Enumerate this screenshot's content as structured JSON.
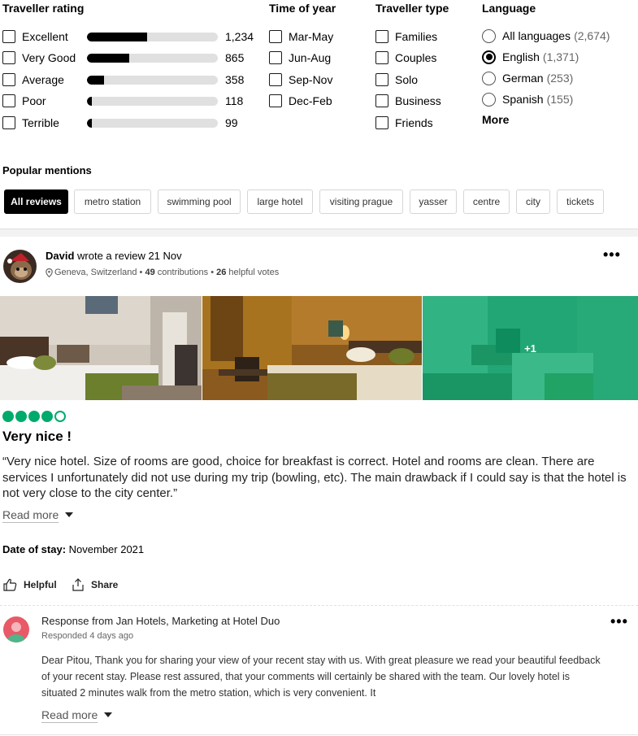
{
  "filters": {
    "rating": {
      "title": "Traveller rating",
      "items": [
        {
          "label": "Excellent",
          "count": "1,234",
          "fraction": 0.46
        },
        {
          "label": "Very Good",
          "count": "865",
          "fraction": 0.32
        },
        {
          "label": "Average",
          "count": "358",
          "fraction": 0.13
        },
        {
          "label": "Poor",
          "count": "118",
          "fraction": 0.04
        },
        {
          "label": "Terrible",
          "count": "99",
          "fraction": 0.035
        }
      ]
    },
    "time": {
      "title": "Time of year",
      "items": [
        "Mar-May",
        "Jun-Aug",
        "Sep-Nov",
        "Dec-Feb"
      ]
    },
    "type": {
      "title": "Traveller type",
      "items": [
        "Families",
        "Couples",
        "Solo",
        "Business",
        "Friends"
      ]
    },
    "language": {
      "title": "Language",
      "items": [
        {
          "label": "All languages",
          "count": "(2,674)",
          "selected": false
        },
        {
          "label": "English",
          "count": "(1,371)",
          "selected": true
        },
        {
          "label": "German",
          "count": "(253)",
          "selected": false
        },
        {
          "label": "Spanish",
          "count": "(155)",
          "selected": false
        }
      ],
      "more": "More"
    }
  },
  "popular": {
    "title": "Popular mentions",
    "chips": [
      "All reviews",
      "metro station",
      "swimming pool",
      "large hotel",
      "visiting prague",
      "yasser",
      "centre",
      "city",
      "tickets"
    ]
  },
  "review": {
    "author": "David",
    "action_text": " wrote a review 21 Nov",
    "location": "Geneva, Switzerland",
    "contributions": "49",
    "contributions_label": " contributions",
    "helpful_votes": "26",
    "helpful_votes_label": " helpful votes",
    "sep": " • ",
    "more_photos": "+1",
    "rating": 4,
    "rating_max": 5,
    "accent_color": "#00aa6c",
    "title": "Very nice !",
    "body": "“Very nice hotel. Size of rooms are good, choice for breakfast is correct. Hotel and rooms are clean. There are services I unfortunately did not use during my trip (bowling, etc). The main drawback if I could say is that the hotel is not very close to the city center.”",
    "read_more": "Read more",
    "date_label": "Date of stay:",
    "date_value": " November 2021",
    "helpful": "Helpful",
    "share": "Share",
    "more_options": "•••"
  },
  "response": {
    "title": "Response from Jan Hotels, Marketing at Hotel Duo",
    "date": "Responded 4 days ago",
    "body": "Dear Pitou, Thank you for sharing your view of your recent stay with us. With great pleasure we read your beautiful feedback of your recent stay. Please rest assured, that your comments will certainly be shared with the team. Our lovely hotel is situated 2 minutes walk from the metro station, which is very convenient. It",
    "read_more": "Read more",
    "more_options": "•••"
  }
}
